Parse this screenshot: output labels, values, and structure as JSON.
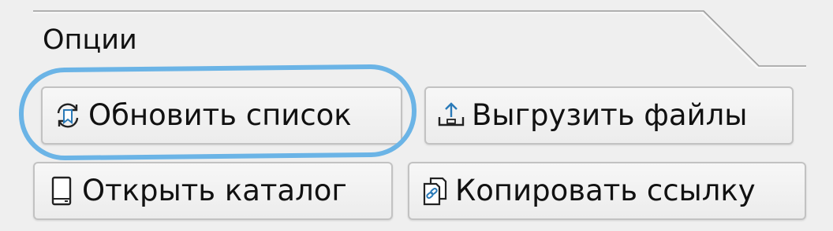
{
  "group": {
    "title": "Опции"
  },
  "buttons": {
    "refresh": {
      "label": "Обновить список",
      "icon": "refresh-bookmark-icon"
    },
    "upload": {
      "label": "Выгрузить файлы",
      "icon": "upload-tray-icon"
    },
    "open_folder": {
      "label": "Открыть каталог",
      "icon": "drive-icon"
    },
    "copy_link": {
      "label": "Копировать ссылку",
      "icon": "copy-link-icon"
    }
  },
  "highlight": {
    "target": "refresh",
    "color": "#6bb4e6"
  },
  "colors": {
    "background": "#efefef",
    "button_border": "#c2c2c2",
    "icon_accent": "#2a7ab8"
  }
}
